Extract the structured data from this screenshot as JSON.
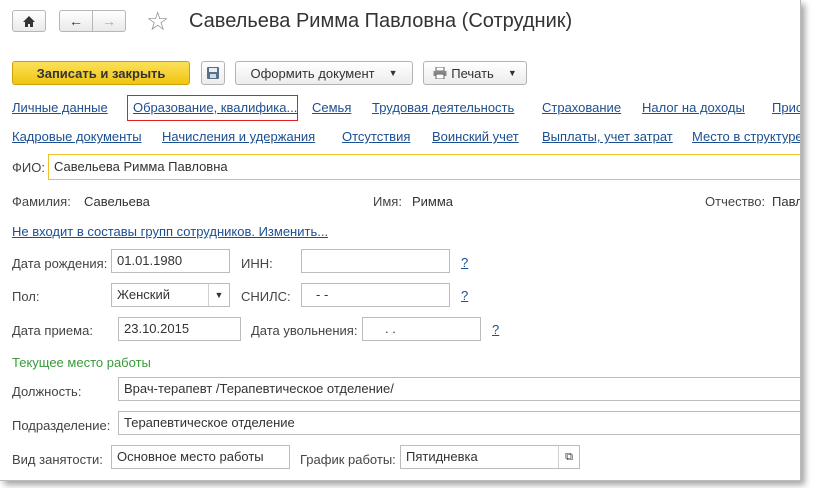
{
  "window": {
    "title": "Савельева Римма Павловна (Сотрудник)",
    "icons": {
      "home": "home-icon",
      "back": "arrow-left-icon",
      "forward": "arrow-right-icon",
      "favorite": "star-icon"
    }
  },
  "toolbar": {
    "save_close": "Записать и закрыть",
    "save_icon": "floppy-disk-icon",
    "make_doc": "Оформить документ",
    "print": "Печать",
    "print_icon": "printer-icon"
  },
  "nav_links_row1": [
    "Личные данные",
    "Образование, квалифика...",
    "Семья",
    "Трудовая деятельность",
    "Страхование",
    "Налог на доходы",
    "Прис"
  ],
  "nav_links_row2": [
    "Кадровые документы",
    "Начисления и удержания",
    "Отсутствия",
    "Воинский учет",
    "Выплаты, учет затрат",
    "Место в структуре"
  ],
  "fio": {
    "label": "ФИО:",
    "value": "Савельева Римма Павловна"
  },
  "name_parts": {
    "last_label": "Фамилия:",
    "last_value": "Савельева",
    "first_label": "Имя:",
    "first_value": "Римма",
    "middle_label": "Отчество:",
    "middle_value": "Павл"
  },
  "groups_link": "Не входит в составы групп сотрудников. Изменить...",
  "birth": {
    "label": "Дата рождения:",
    "value": "01.01.1980"
  },
  "inn": {
    "label": "ИНН:",
    "value": "",
    "help": "?"
  },
  "gender": {
    "label": "Пол:",
    "value": "Женский"
  },
  "snils": {
    "label": "СНИЛС:",
    "value": "-   -",
    "help": "?"
  },
  "hire": {
    "label": "Дата приема:",
    "value": "23.10.2015"
  },
  "dismissal": {
    "label": "Дата увольнения:",
    "value": ".   .",
    "help": "?"
  },
  "current_work": {
    "header": "Текущее место работы",
    "position_label": "Должность:",
    "position_value": "Врач-терапевт /Терапевтическое отделение/",
    "department_label": "Подразделение:",
    "department_value": "Терапевтическое отделение",
    "employment_label": "Вид занятости:",
    "employment_value": "Основное место работы",
    "schedule_label": "График работы:",
    "schedule_value": "Пятидневка"
  },
  "colors": {
    "accent_yellow": "#f1c40f",
    "link_blue": "#1c4f91",
    "highlight_red": "#e02020",
    "section_green": "#3a9a3a"
  }
}
